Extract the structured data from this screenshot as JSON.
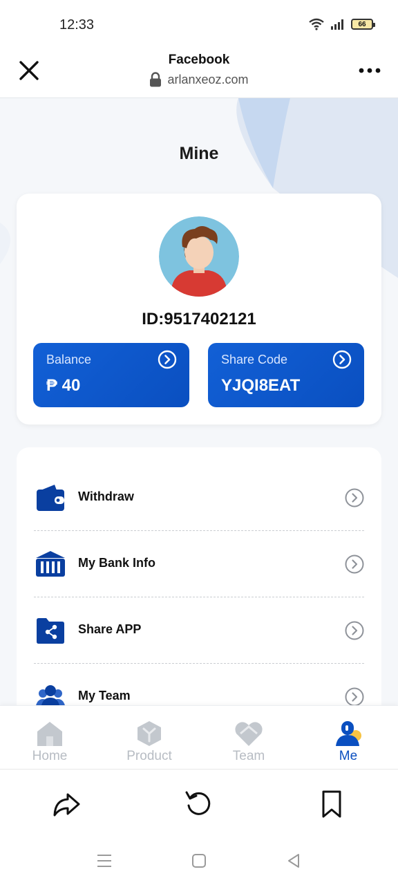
{
  "status": {
    "time": "12:33",
    "battery": "66"
  },
  "browser": {
    "title": "Facebook",
    "url": "arlanxeoz.com"
  },
  "page": {
    "title": "Mine"
  },
  "profile": {
    "id_text": "ID:9517402121",
    "balance_label": "Balance",
    "balance_value": "₱ 40",
    "share_label": "Share Code",
    "share_value": "YJQI8EAT"
  },
  "menu": {
    "items": [
      {
        "label": "Withdraw",
        "icon": "wallet-icon"
      },
      {
        "label": "My Bank Info",
        "icon": "bank-icon"
      },
      {
        "label": "Share APP",
        "icon": "share-folder-icon"
      },
      {
        "label": "My Team",
        "icon": "team-icon"
      }
    ]
  },
  "tabs": [
    {
      "label": "Home",
      "icon": "home-icon",
      "active": false
    },
    {
      "label": "Product",
      "icon": "product-icon",
      "active": false
    },
    {
      "label": "Team",
      "icon": "team-heart-icon",
      "active": false
    },
    {
      "label": "Me",
      "icon": "me-icon",
      "active": true
    }
  ],
  "colors": {
    "accent": "#0a4fc0",
    "inactive": "#b7bcc3",
    "background": "#f5f7fa"
  }
}
